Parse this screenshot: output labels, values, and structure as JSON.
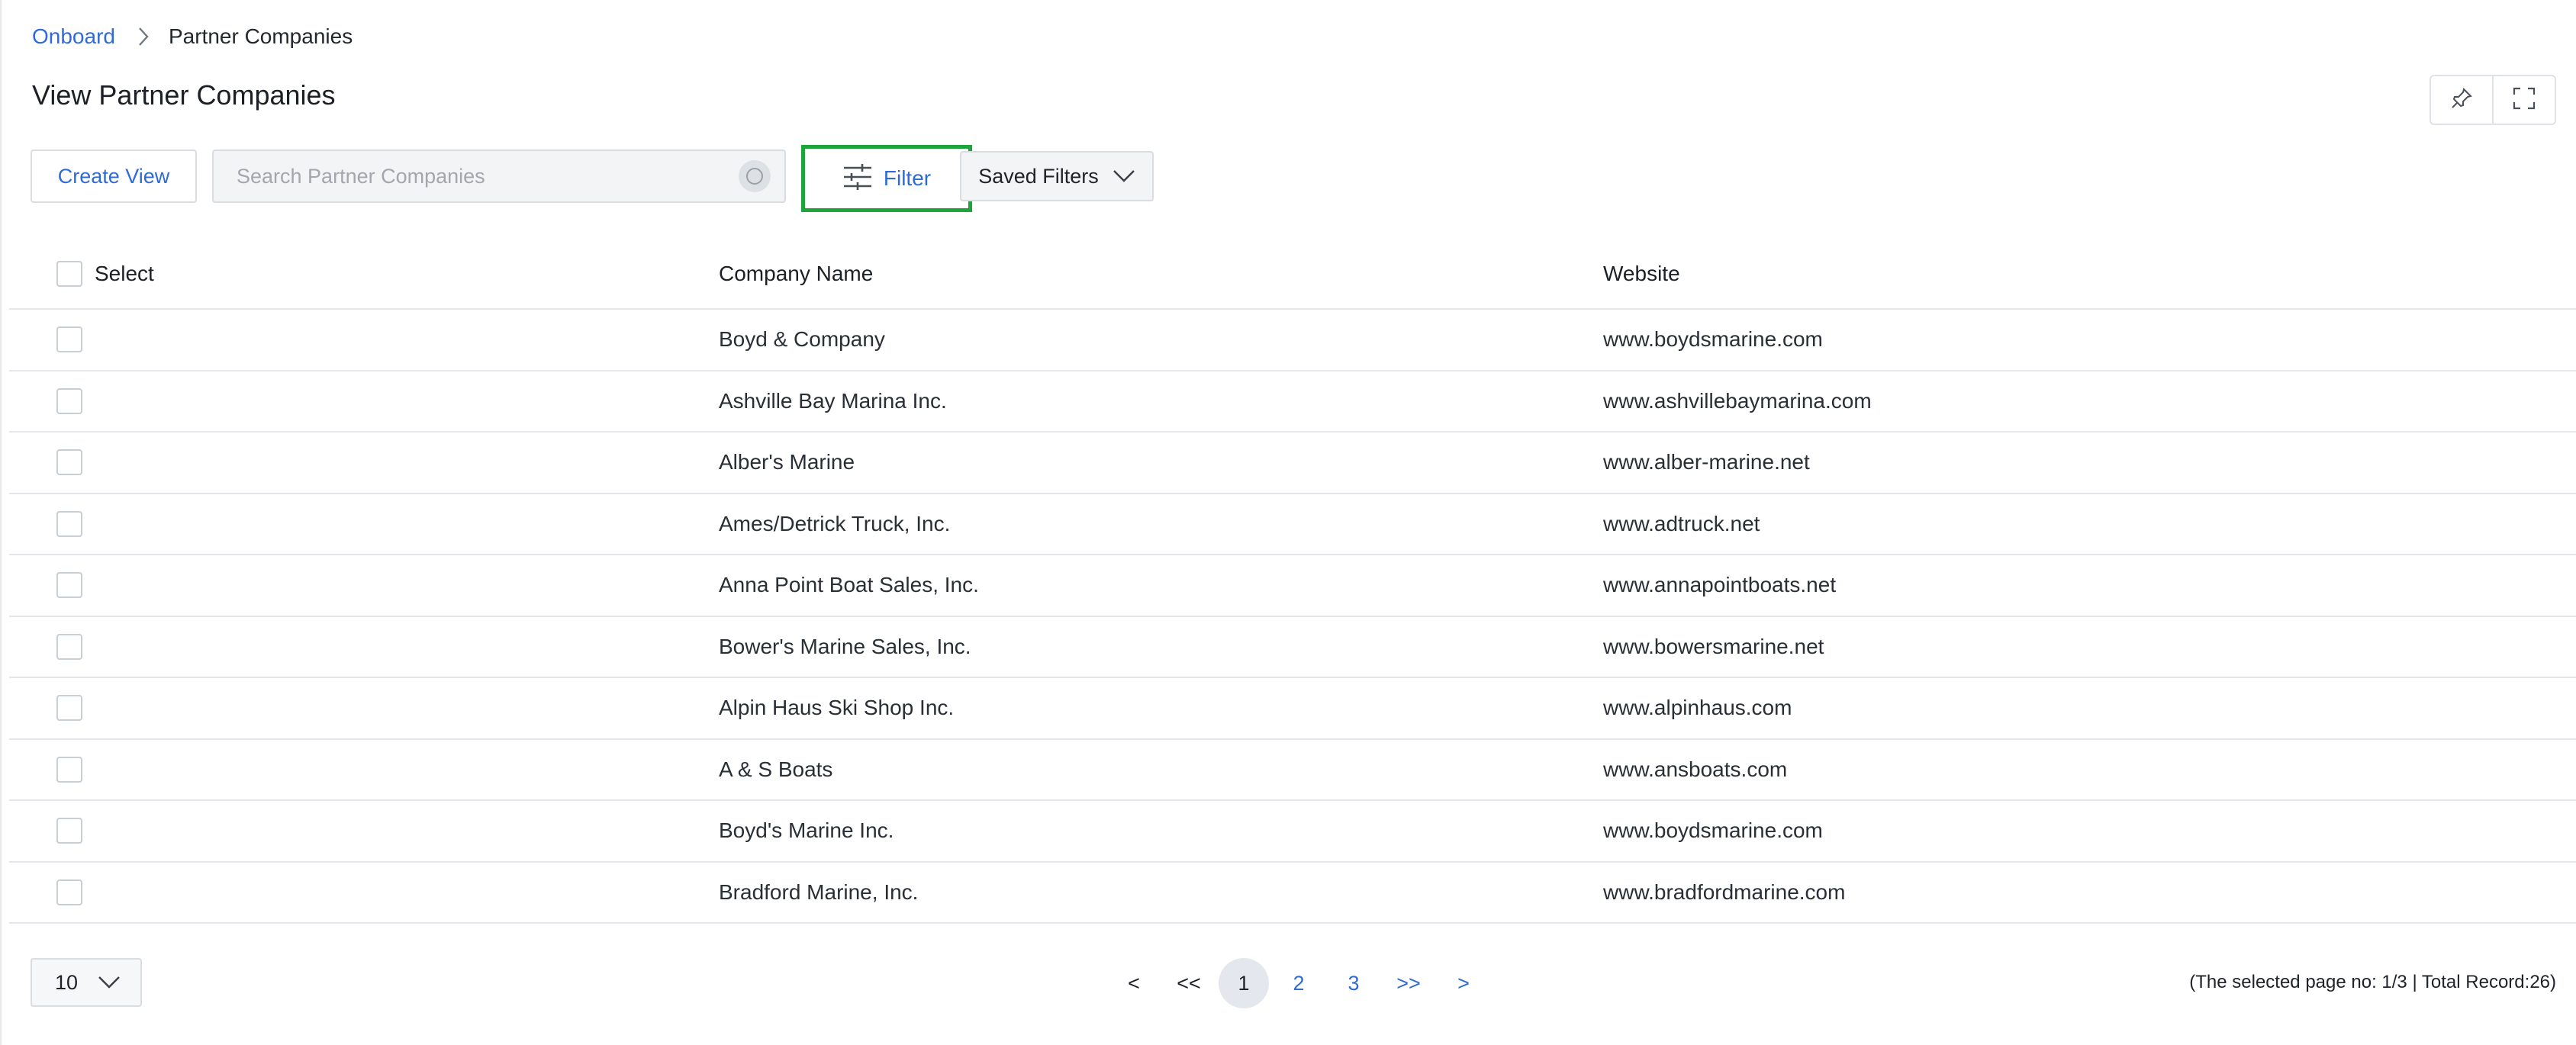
{
  "breadcrumb": {
    "root": "Onboard",
    "current": "Partner Companies"
  },
  "page": {
    "title": "View Partner Companies"
  },
  "window_controls": [
    "pin-icon",
    "fullscreen-icon"
  ],
  "toolbar": {
    "create_view_label": "Create View",
    "search_placeholder": "Search Partner Companies",
    "search_value": "",
    "filter_label": "Filter",
    "saved_filters_label": "Saved Filters"
  },
  "table": {
    "headers": {
      "select": "Select",
      "company": "Company Name",
      "website": "Website"
    },
    "rows": [
      {
        "company": "Boyd & Company",
        "website": "www.boydsmarine.com"
      },
      {
        "company": "Ashville Bay Marina Inc.",
        "website": "www.ashvillebaymarina.com"
      },
      {
        "company": "Alber's Marine",
        "website": "www.alber-marine.net"
      },
      {
        "company": "Ames/Detrick Truck, Inc.",
        "website": "www.adtruck.net"
      },
      {
        "company": "Anna Point Boat Sales, Inc.",
        "website": "www.annapointboats.net"
      },
      {
        "company": "Bower's Marine Sales, Inc.",
        "website": "www.bowersmarine.net"
      },
      {
        "company": "Alpin Haus Ski Shop Inc.",
        "website": "www.alpinhaus.com"
      },
      {
        "company": "A & S Boats",
        "website": "www.ansboats.com"
      },
      {
        "company": "Boyd's Marine Inc.",
        "website": "www.boydsmarine.com"
      },
      {
        "company": "Bradford Marine, Inc.",
        "website": "www.bradfordmarine.com"
      }
    ]
  },
  "pagination": {
    "page_size": "10",
    "prev": "<",
    "first": "<<",
    "pages": [
      "1",
      "2",
      "3"
    ],
    "active_page": "1",
    "last": ">>",
    "next": ">",
    "record_info": "(The selected page no: 1/3 | Total Record:26)"
  },
  "colors": {
    "accent": "#2f6bd6",
    "highlight": "#1fa33b",
    "border": "#d9dde2"
  }
}
